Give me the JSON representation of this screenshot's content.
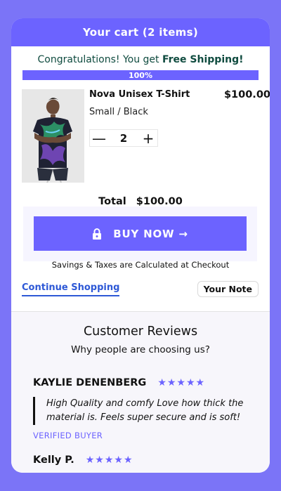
{
  "header": {
    "title": "Your cart (2 items)"
  },
  "shipping": {
    "prefix": "Congratulations! You get ",
    "highlight": "Free Shipping!",
    "progress_percent": 100,
    "progress_label": "100%"
  },
  "item": {
    "title": "Nova Unisex T-Shirt",
    "price": "$100.00",
    "variant": "Small / Black",
    "quantity": "2",
    "minus_symbol": "—",
    "plus_symbol": "+"
  },
  "total": {
    "label": "Total",
    "amount": "$100.00"
  },
  "buy_button": {
    "label": "BUY NOW →",
    "icon": "lock-icon"
  },
  "savings_note": "Savings & Taxes are Calculated at Checkout",
  "continue_link": "Continue Shopping",
  "note_button": "Your Note",
  "reviews": {
    "title": "Customer Reviews",
    "subtitle": "Why people are choosing us?",
    "items": [
      {
        "name": "KAYLIE DENENBERG",
        "stars": "★★★★★",
        "rating": 5,
        "text": "High Quality and comfy Love how thick the material is. Feels super secure and is soft!",
        "badge": "VERIFIED BUYER"
      },
      {
        "name": "Kelly P.",
        "stars": "★★★★★",
        "rating": 5
      }
    ]
  },
  "colors": {
    "accent": "#6c63ff",
    "background": "#7b74f7",
    "shipping_text": "#0f4b3f",
    "link": "#2d58d6"
  }
}
